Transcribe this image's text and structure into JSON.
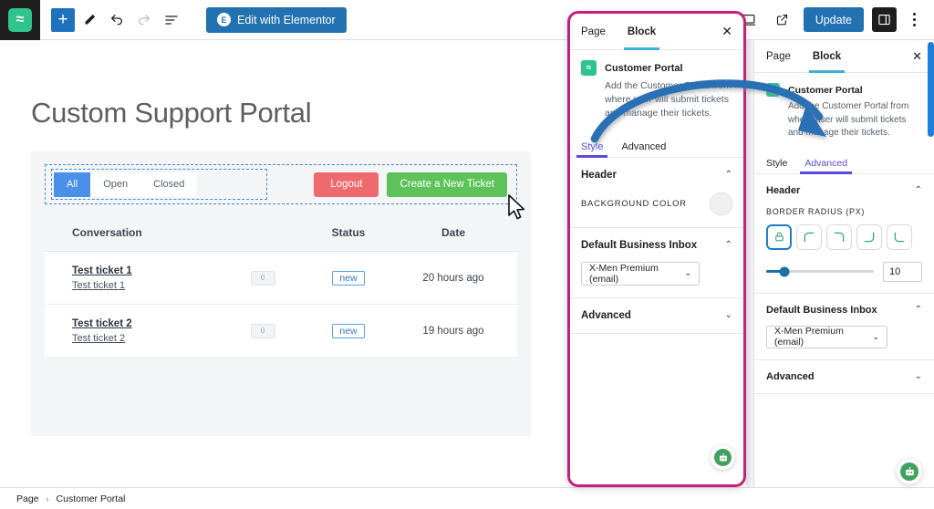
{
  "toolbar": {
    "logo_glyph": "≈",
    "add_block_label": "+",
    "tools": [
      "pencil-icon",
      "undo-icon",
      "redo-icon",
      "list-view-icon"
    ],
    "elementor_button": "Edit with Elementor",
    "elementor_badge": "E",
    "view_icon": "desktop-icon",
    "preview_icon": "external-link-icon",
    "update_button": "Update",
    "settings_toggle": "settings-panel-icon",
    "options_menu": "more-options-icon"
  },
  "canvas": {
    "page_heading": "Custom Support Portal",
    "filters": [
      {
        "label": "All",
        "active": true
      },
      {
        "label": "Open",
        "active": false
      },
      {
        "label": "Closed",
        "active": false
      }
    ],
    "logout_button": "Logout",
    "new_ticket_button": "Create a New Ticket",
    "table": {
      "columns": [
        "Conversation",
        "",
        "Status",
        "Date"
      ],
      "rows": [
        {
          "title": "Test ticket 1",
          "subtitle": "Test ticket 1",
          "count": "0",
          "status": "new",
          "date": "20 hours ago"
        },
        {
          "title": "Test ticket 2",
          "subtitle": "Test ticket 2",
          "count": "0",
          "status": "new",
          "date": "19 hours ago"
        }
      ]
    }
  },
  "zoom_panel": {
    "tabs": [
      {
        "label": "Page",
        "active": false
      },
      {
        "label": "Block",
        "active": true
      }
    ],
    "close_label": "✕",
    "block_name": "Customer Portal",
    "block_icon_glyph": "≈",
    "block_description": "Add the Customer Portal from where user will submit tickets and manage their tickets.",
    "sub_tabs": [
      {
        "label": "Style",
        "active": true
      },
      {
        "label": "Advanced",
        "active": false
      }
    ],
    "sections": [
      {
        "title": "Header",
        "expanded": true,
        "chevron": "⌃",
        "field_label": "BACKGROUND COLOR",
        "color_value": "#f0f0f2"
      },
      {
        "title": "Default Business Inbox",
        "expanded": true,
        "chevron": "⌃",
        "select_value": "X-Men Premium (email)",
        "select_caret": "⌄"
      },
      {
        "title": "Advanced",
        "expanded": false,
        "chevron": "⌄"
      }
    ],
    "bot_widget": "chat-bot-icon"
  },
  "sidebar": {
    "tabs": [
      {
        "label": "Page",
        "active": false
      },
      {
        "label": "Block",
        "active": true
      }
    ],
    "close_label": "✕",
    "block_name": "Customer Portal",
    "block_icon_glyph": "≈",
    "block_description": "Add the Customer Portal from where user will submit tickets and manage their tickets.",
    "sub_tabs": [
      {
        "label": "Style",
        "active": false
      },
      {
        "label": "Advanced",
        "active": true
      }
    ],
    "header_section": {
      "title": "Header",
      "chevron": "⌃",
      "field_label": "BORDER RADIUS (PX)",
      "radius_buttons": [
        "lock-all-corners-icon",
        "top-left-corner-icon",
        "top-right-corner-icon",
        "bottom-right-corner-icon",
        "bottom-left-corner-icon"
      ],
      "selected_radius_button": 0,
      "slider_value": "10",
      "slider_percent": 17
    },
    "inbox_section": {
      "title": "Default Business Inbox",
      "chevron": "⌃",
      "select_value": "X-Men Premium (email)",
      "select_caret": "⌄"
    },
    "advanced_section": {
      "title": "Advanced",
      "chevron": "⌄"
    }
  },
  "bottombar": {
    "breadcrumb": [
      "Page",
      "Customer Portal"
    ],
    "separator": "›"
  },
  "annotation": {
    "arrow_color": "#2a6fb5",
    "highlight_border_color": "#c4227a"
  },
  "bot_widget_global": "chat-bot-icon"
}
